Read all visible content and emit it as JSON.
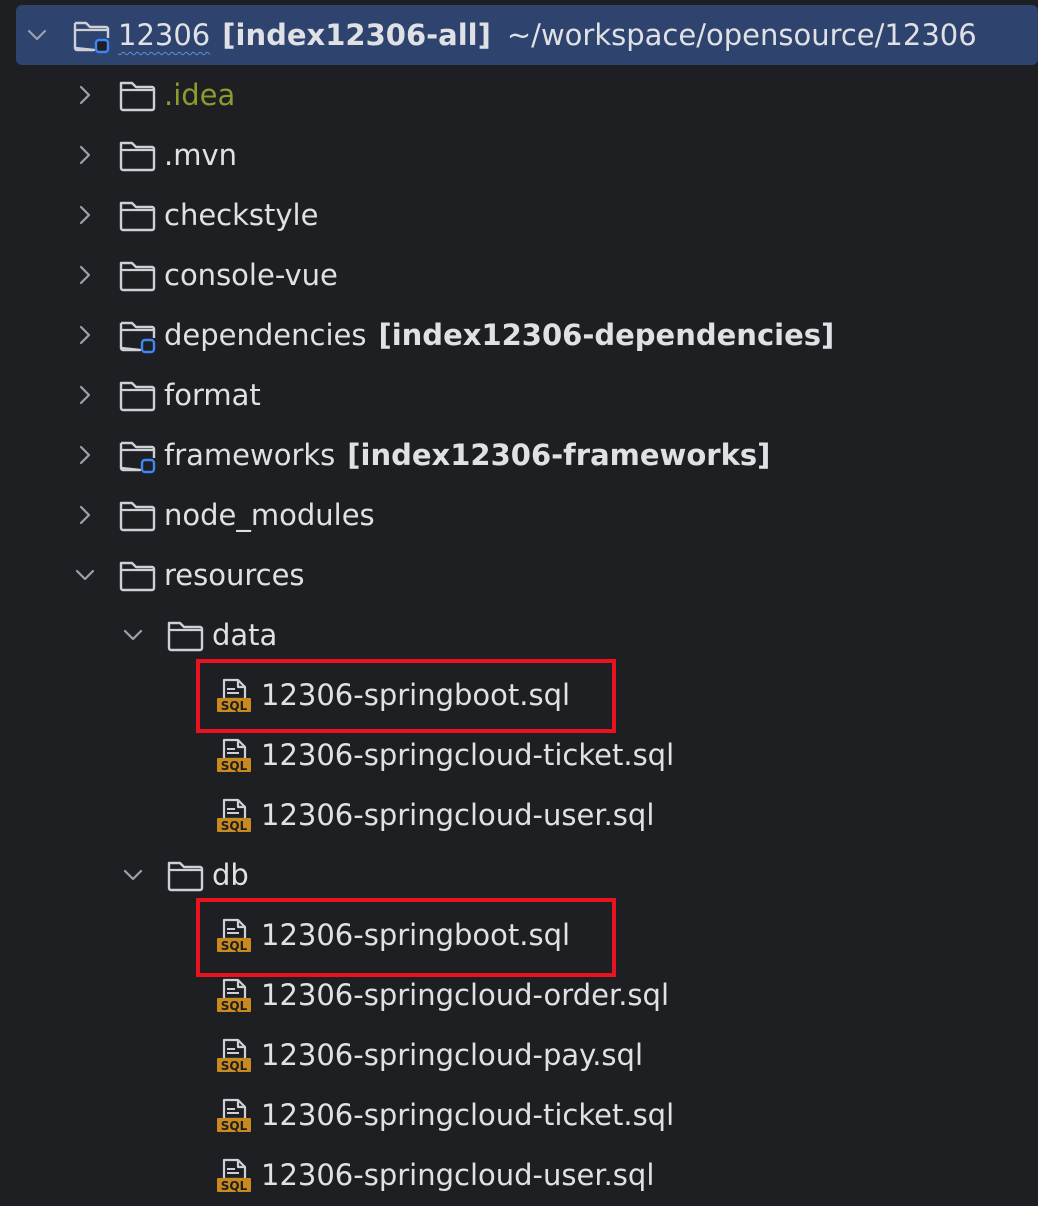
{
  "root": {
    "name": "12306",
    "module": "[index12306-all]",
    "path": "~/workspace/opensource/12306"
  },
  "items": {
    "idea": ".idea",
    "mvn": ".mvn",
    "checkstyle": "checkstyle",
    "console_vue": "console-vue",
    "dependencies": "dependencies",
    "dependencies_module": "[index12306-dependencies]",
    "format": "format",
    "frameworks": "frameworks",
    "frameworks_module": "[index12306-frameworks]",
    "node_modules": "node_modules",
    "resources": "resources",
    "data": "data",
    "db": "db"
  },
  "data_files": [
    "12306-springboot.sql",
    "12306-springcloud-ticket.sql",
    "12306-springcloud-user.sql"
  ],
  "db_files": [
    "12306-springboot.sql",
    "12306-springcloud-order.sql",
    "12306-springcloud-pay.sql",
    "12306-springcloud-ticket.sql",
    "12306-springcloud-user.sql"
  ],
  "sql_badge": "SQL",
  "colors": {
    "background": "#1e1f22",
    "selection": "#2e436e",
    "highlight_box": "#e8131e",
    "idea_text": "#8d9a2d",
    "sql_icon": "#c88a1e"
  }
}
